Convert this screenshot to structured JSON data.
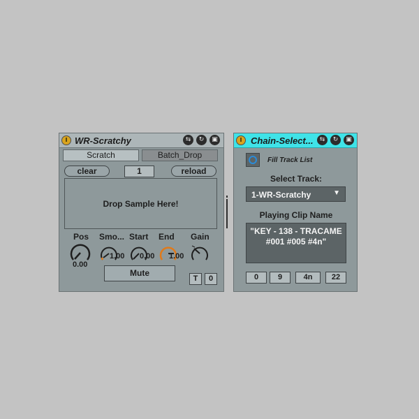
{
  "device1": {
    "title": "WR-Scratchy",
    "tabs": [
      "Scratch",
      "Batch_Drop"
    ],
    "clear_label": "clear",
    "number_value": "1",
    "reload_label": "reload",
    "drop_text": "Drop Sample Here!",
    "knobs": [
      {
        "label": "Pos",
        "value": "0.00"
      },
      {
        "label": "Smo...",
        "value": "1.00"
      },
      {
        "label": "Start",
        "value": "0.00"
      },
      {
        "label": "End",
        "value": "1.00"
      },
      {
        "label": "Gain",
        "value": ""
      }
    ],
    "mute_label": "Mute",
    "t_label": "T",
    "t_value": "0"
  },
  "device2": {
    "title": "Chain-Select...",
    "fill_label": "Fill Track List",
    "select_track_label": "Select Track:",
    "selected_track": "1-WR-Scratchy",
    "playing_clip_label": "Playing Clip Name",
    "clip_name_line1": "\"KEY - 138 - TRACAME",
    "clip_name_line2": "#001 #005 #4n\"",
    "boxes": [
      "0",
      "9",
      "4n",
      "22"
    ]
  },
  "colors": {
    "device_bg": "#8e999b",
    "title_bar": "#adb6b8",
    "title_bar_selected": "#3fe3e8",
    "knob_accent": "#e07a1a",
    "power_led": "#d9a41e"
  }
}
